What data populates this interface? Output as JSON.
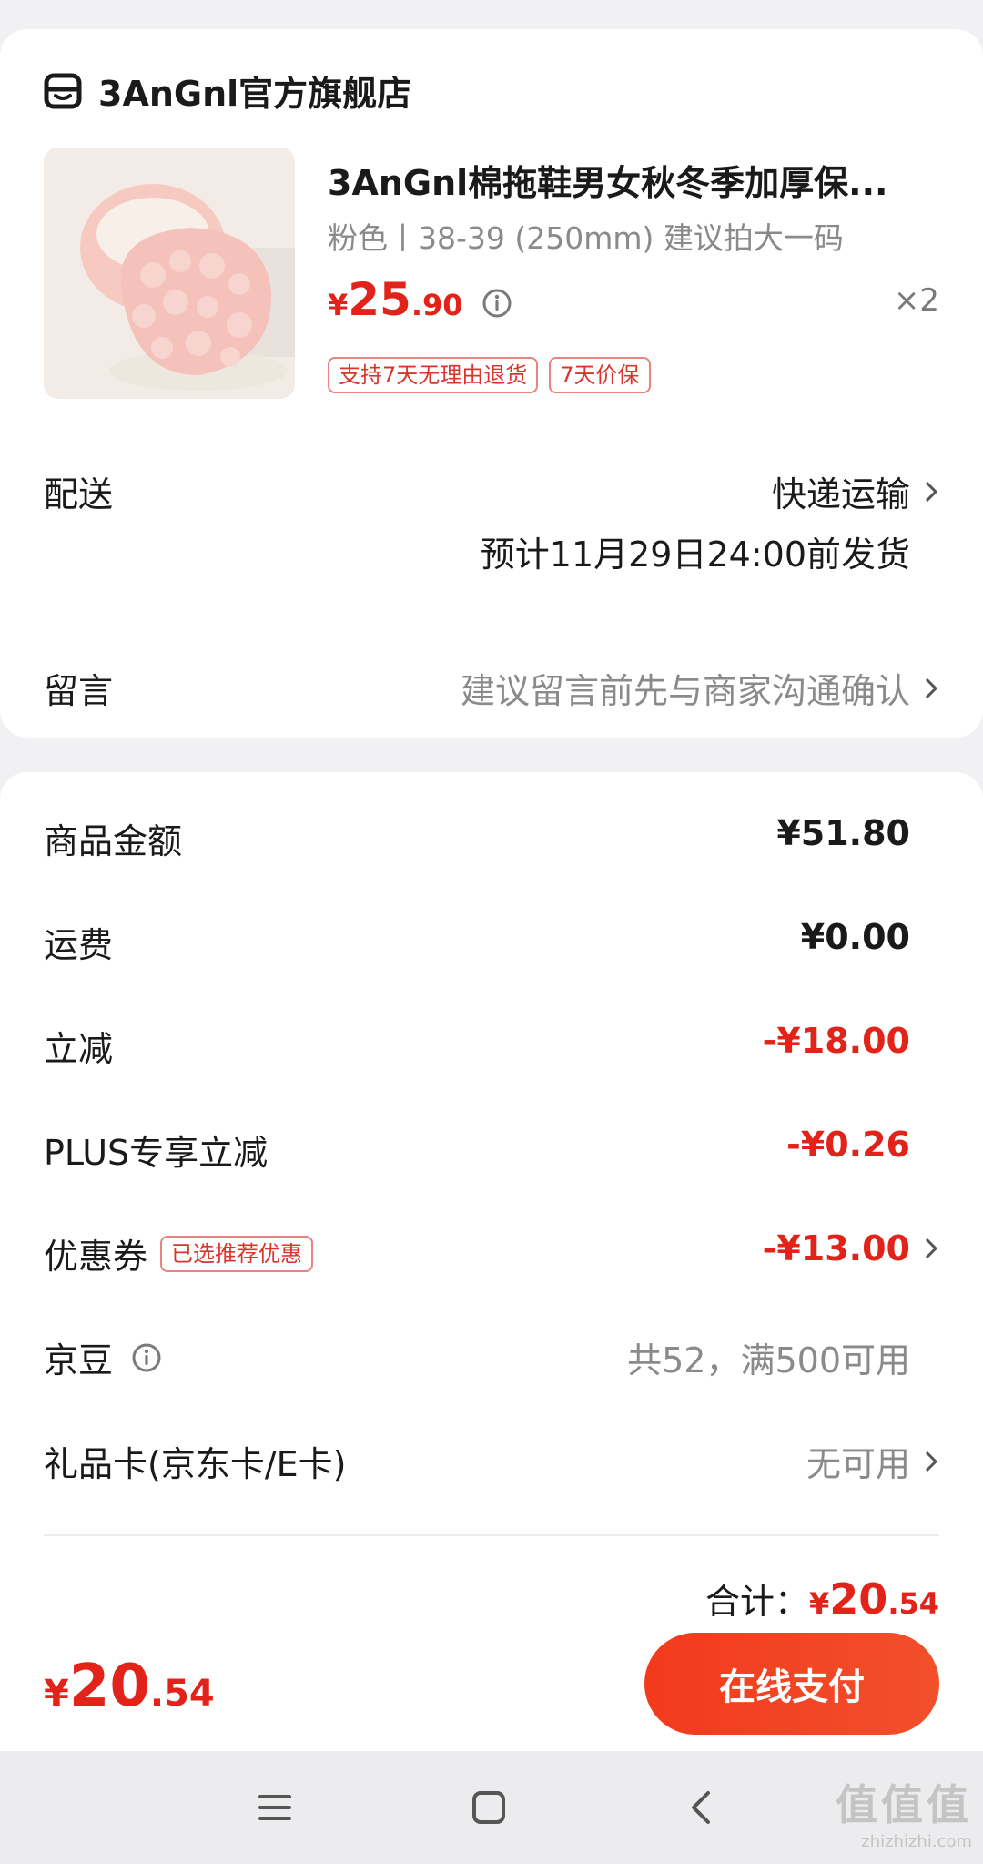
{
  "store": {
    "name": "3AnGnl官方旗舰店",
    "icon": "store-icon"
  },
  "product": {
    "title": "3AnGnl棉拖鞋男女秋冬季加厚保...",
    "spec": "粉色丨38-39 (250mm) 建议拍大一码",
    "price_currency": "¥",
    "price_int": "25",
    "price_dec": ".90",
    "quantity": "×2",
    "tags": [
      "支持7天无理由退货",
      "7天价保"
    ]
  },
  "delivery": {
    "label": "配送",
    "method": "快递运输",
    "eta": "预计11月29日24:00前发货"
  },
  "message": {
    "label": "留言",
    "placeholder": "建议留言前先与商家沟通确认"
  },
  "summary": {
    "goods_label": "商品金额",
    "goods_value": "¥51.80",
    "shipping_label": "运费",
    "shipping_value": "¥0.00",
    "discount_label": "立减",
    "discount_value": "-¥18.00",
    "plus_label": "PLUS专享立减",
    "plus_value": "-¥0.26",
    "coupon_label": "优惠券",
    "coupon_badge": "已选推荐优惠",
    "coupon_value": "-¥13.00",
    "jingdou_label": "京豆",
    "jingdou_value": "共52，满500可用",
    "giftcard_label": "礼品卡(京东卡/E卡)",
    "giftcard_value": "无可用",
    "total_label": "合计：",
    "total_currency": "¥",
    "total_int": "20",
    "total_dec": ".54"
  },
  "bottom_bar": {
    "currency": "¥",
    "price_int": "20",
    "price_dec": ".54",
    "pay_label": "在线支付"
  },
  "watermark": {
    "big": "值值值",
    "small": "zhizhizhi.com"
  },
  "colors": {
    "accent": "#e2231a",
    "pay_button": "#f23a1c"
  }
}
